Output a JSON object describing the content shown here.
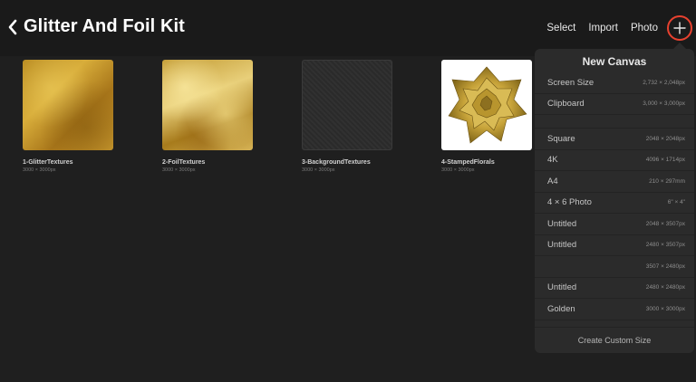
{
  "header": {
    "title": "Glitter And Foil Kit",
    "actions": {
      "select": "Select",
      "import": "Import",
      "photo": "Photo"
    },
    "plus_highlight_color": "#e8412f"
  },
  "gallery": {
    "items": [
      {
        "name": "1-GlitterTextures",
        "size": "3000 × 3000px"
      },
      {
        "name": "2-FoilTextures",
        "size": "3000 × 3000px"
      },
      {
        "name": "3-BackgroundTextures",
        "size": "3000 × 3000px"
      },
      {
        "name": "4-StampedFlorals",
        "size": "3000 × 3000px"
      }
    ]
  },
  "new_canvas": {
    "title": "New Canvas",
    "rows": [
      {
        "label": "Screen Size",
        "size": "2,732 × 2,048px"
      },
      {
        "label": "Clipboard",
        "size": "3,000 × 3,000px"
      },
      {
        "label": "Square",
        "size": "2048 × 2048px"
      },
      {
        "label": "4K",
        "size": "4096 × 1714px"
      },
      {
        "label": "A4",
        "size": "210 × 297mm"
      },
      {
        "label": "4 × 6 Photo",
        "size": "6\" × 4\""
      },
      {
        "label": "Untitled",
        "size": "2048 × 3507px"
      },
      {
        "label": "Untitled",
        "size": "2480 × 3507px"
      },
      {
        "label": "",
        "size": "3507 × 2480px"
      },
      {
        "label": "Untitled",
        "size": "2480 × 2480px"
      },
      {
        "label": "Golden",
        "size": "3000 × 3000px"
      }
    ],
    "create_custom": "Create Custom Size"
  }
}
